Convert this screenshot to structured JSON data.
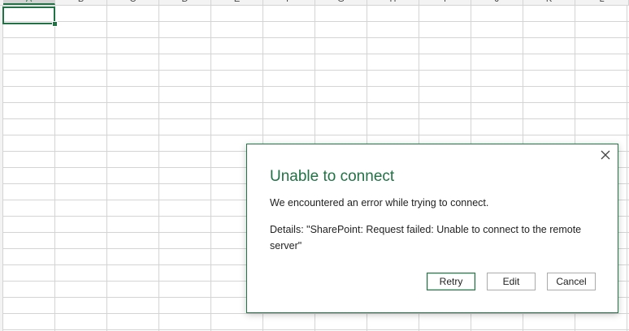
{
  "sheet": {
    "columns": [
      "A",
      "B",
      "C",
      "D",
      "E",
      "F",
      "G",
      "H",
      "I",
      "J",
      "K",
      "L"
    ],
    "selected_column": "A",
    "accent_color": "#217346"
  },
  "dialog": {
    "title": "Unable to connect",
    "message": "We encountered an error while trying to connect.",
    "details": "Details: \"SharePoint: Request failed: Unable to connect to the remote server\"",
    "buttons": {
      "retry": "Retry",
      "edit": "Edit",
      "cancel": "Cancel"
    },
    "close_icon": "close-icon"
  }
}
